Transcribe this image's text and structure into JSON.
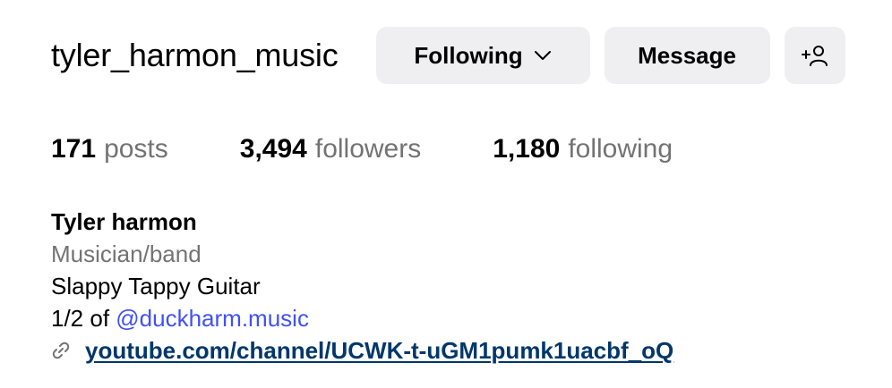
{
  "profile": {
    "username": "tyler_harmon_music",
    "full_name": "Tyler harmon",
    "category": "Musician/band",
    "bio_line1": "Slappy Tappy Guitar",
    "bio_line2_prefix": "1/2 of ",
    "bio_mention": "@duckharm.music",
    "link_text": "youtube.com/channel/UCWK-t-uGM1pumk1uacbf_oQ"
  },
  "actions": {
    "following_label": "Following",
    "message_label": "Message",
    "add_user_icon": "person-add-icon",
    "following_icon": "chevron-down-icon"
  },
  "stats": {
    "posts_count": "171",
    "posts_label": "posts",
    "followers_count": "3,494",
    "followers_label": "followers",
    "following_count": "1,180",
    "following_label": "following"
  },
  "colors": {
    "button_bg": "#efeff2",
    "secondary_text": "#737373",
    "mention": "#4150f7",
    "link": "#00376b"
  },
  "icons": {
    "link_icon": "link-icon"
  }
}
